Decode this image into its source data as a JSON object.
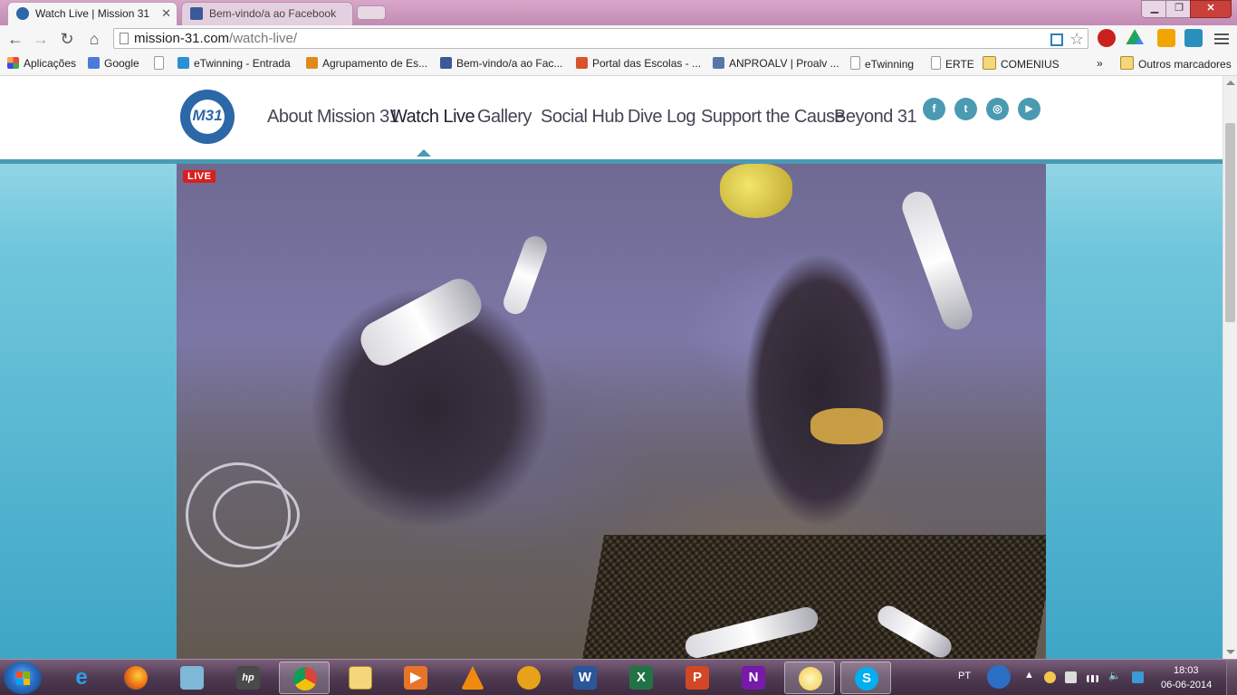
{
  "browser": {
    "tabs": [
      {
        "title": "Watch Live | Mission 31",
        "active": true
      },
      {
        "title": "Bem-vindo/a ao Facebook",
        "active": false
      }
    ],
    "url_host": "mission-31.com",
    "url_path": "/watch-live/",
    "bookmarks": [
      {
        "label": "Aplicações",
        "icon": "apps-grid-icon"
      },
      {
        "label": "Google",
        "icon": "google-icon"
      },
      {
        "label": "",
        "icon": "page-icon"
      },
      {
        "label": "eTwinning - Entrada",
        "icon": "etwinning-icon"
      },
      {
        "label": "Agrupamento de Es...",
        "icon": "school-icon"
      },
      {
        "label": "Bem-vindo/a ao Fac...",
        "icon": "facebook-icon"
      },
      {
        "label": "Portal das Escolas - ...",
        "icon": "portal-icon"
      },
      {
        "label": "ANPROALV | Proalv ...",
        "icon": "anproalv-icon"
      },
      {
        "label": "eTwinning",
        "icon": "page-icon"
      },
      {
        "label": "ERTE",
        "icon": "page-icon"
      },
      {
        "label": "COMENIUS",
        "icon": "folder-icon"
      }
    ],
    "bookmarks_overflow": "»",
    "other_bookmarks": "Outros marcadores"
  },
  "site": {
    "logo_text": "M31",
    "nav": [
      "About Mission 31",
      "Watch Live",
      "Gallery",
      "Social Hub",
      "Dive Log",
      "Support the Cause",
      "Beyond 31"
    ],
    "active_nav": "Watch Live",
    "social": [
      {
        "icon": "facebook-icon",
        "glyph": "f"
      },
      {
        "icon": "twitter-icon",
        "glyph": "t"
      },
      {
        "icon": "instagram-icon",
        "glyph": "◎"
      },
      {
        "icon": "youtube-icon",
        "glyph": "▶"
      }
    ],
    "video": {
      "live_label": "LIVE"
    }
  },
  "taskbar": {
    "language": "PT",
    "time": "18:03",
    "date": "06-06-2014",
    "apps": [
      "internet-explorer",
      "firefox",
      "camera-app",
      "hp-app",
      "chrome",
      "file-explorer",
      "media-app",
      "vlc",
      "audio-app",
      "word",
      "excel",
      "powerpoint",
      "onenote",
      "weather-gadget",
      "skype"
    ],
    "active_app": "chrome"
  },
  "colors": {
    "accent": "#4a9ab2",
    "live_red": "#d81f1f"
  }
}
